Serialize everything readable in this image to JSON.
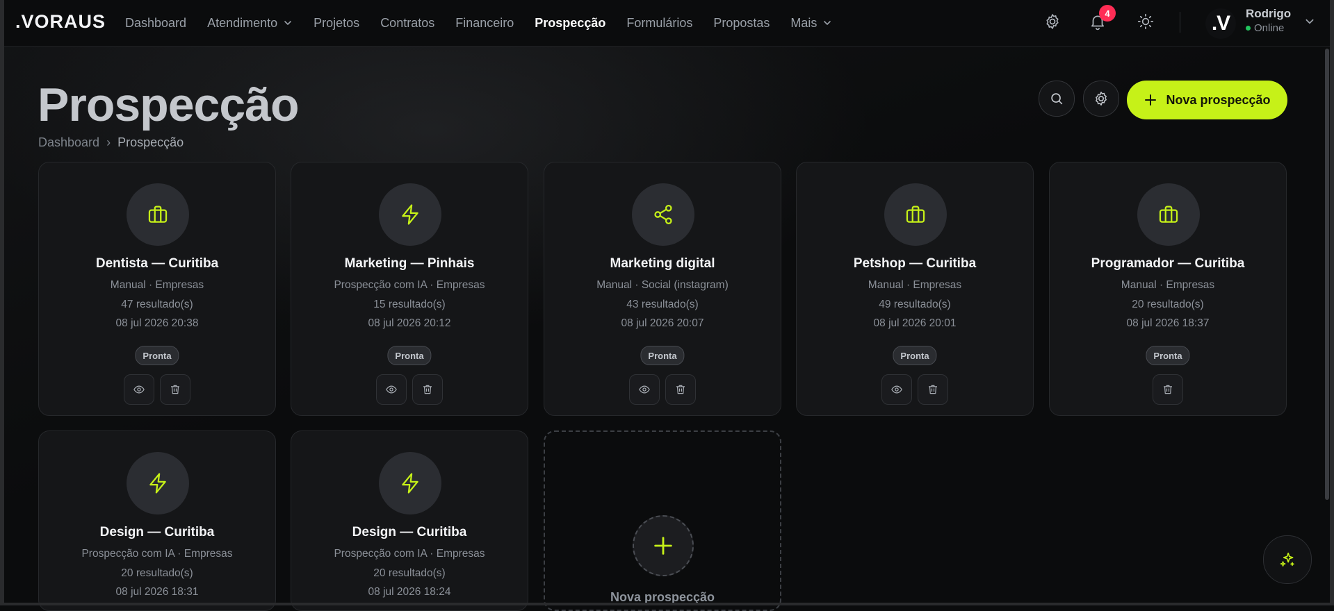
{
  "brand": {
    "logo": ".VORAUS",
    "accent": "#c6f118"
  },
  "nav": {
    "items": [
      {
        "label": "Dashboard"
      },
      {
        "label": "Atendimento"
      },
      {
        "label": "Projetos"
      },
      {
        "label": "Contratos"
      },
      {
        "label": "Financeiro"
      },
      {
        "label": "Prospecção"
      },
      {
        "label": "Formulários"
      },
      {
        "label": "Propostas"
      },
      {
        "label": "Mais"
      }
    ],
    "notifications_count": "4",
    "avatar_initial": ".V",
    "user_name": "Rodrigo",
    "user_status": "Online"
  },
  "page": {
    "title": "Prospecção",
    "breadcrumb": [
      "Dashboard",
      "›",
      "Prospecção"
    ],
    "new_button_label": "Nova prospecção"
  },
  "cards": [
    {
      "icon": "briefcase-icon",
      "title": "Dentista — Curitiba",
      "type": "Manual · Empresas",
      "results": "47 resultado(s)",
      "date": "08 jul 2026 20:38",
      "status": "Pronta"
    },
    {
      "icon": "lightning-icon",
      "title": "Marketing — Pinhais",
      "type": "Prospecção com IA · Empresas",
      "results": "15 resultado(s)",
      "date": "08 jul 2026 20:12",
      "status": "Pronta"
    },
    {
      "icon": "share-icon",
      "title": "Marketing digital",
      "type": "Manual · Social (instagram)",
      "results": "43 resultado(s)",
      "date": "08 jul 2026 20:07",
      "status": "Pronta"
    },
    {
      "icon": "briefcase-icon",
      "title": "Petshop — Curitiba",
      "type": "Manual · Empresas",
      "results": "49 resultado(s)",
      "date": "08 jul 2026 20:01",
      "status": "Pronta"
    },
    {
      "icon": "briefcase-icon",
      "title": "Programador — Curitiba",
      "type": "Manual · Empresas",
      "results": "20 resultado(s)",
      "date": "08 jul 2026 18:37",
      "status": "Pronta"
    },
    {
      "icon": "lightning-icon",
      "title": "Design — Curitiba",
      "type": "Prospecção com IA · Empresas",
      "results": "20 resultado(s)",
      "date": "08 jul 2026 18:31"
    },
    {
      "icon": "lightning-icon",
      "title": "Design — Curitiba",
      "type": "Prospecção com IA · Empresas",
      "results": "20 resultado(s)",
      "date": "08 jul 2026 18:24"
    }
  ],
  "new_card": {
    "label": "Nova prospecção"
  }
}
